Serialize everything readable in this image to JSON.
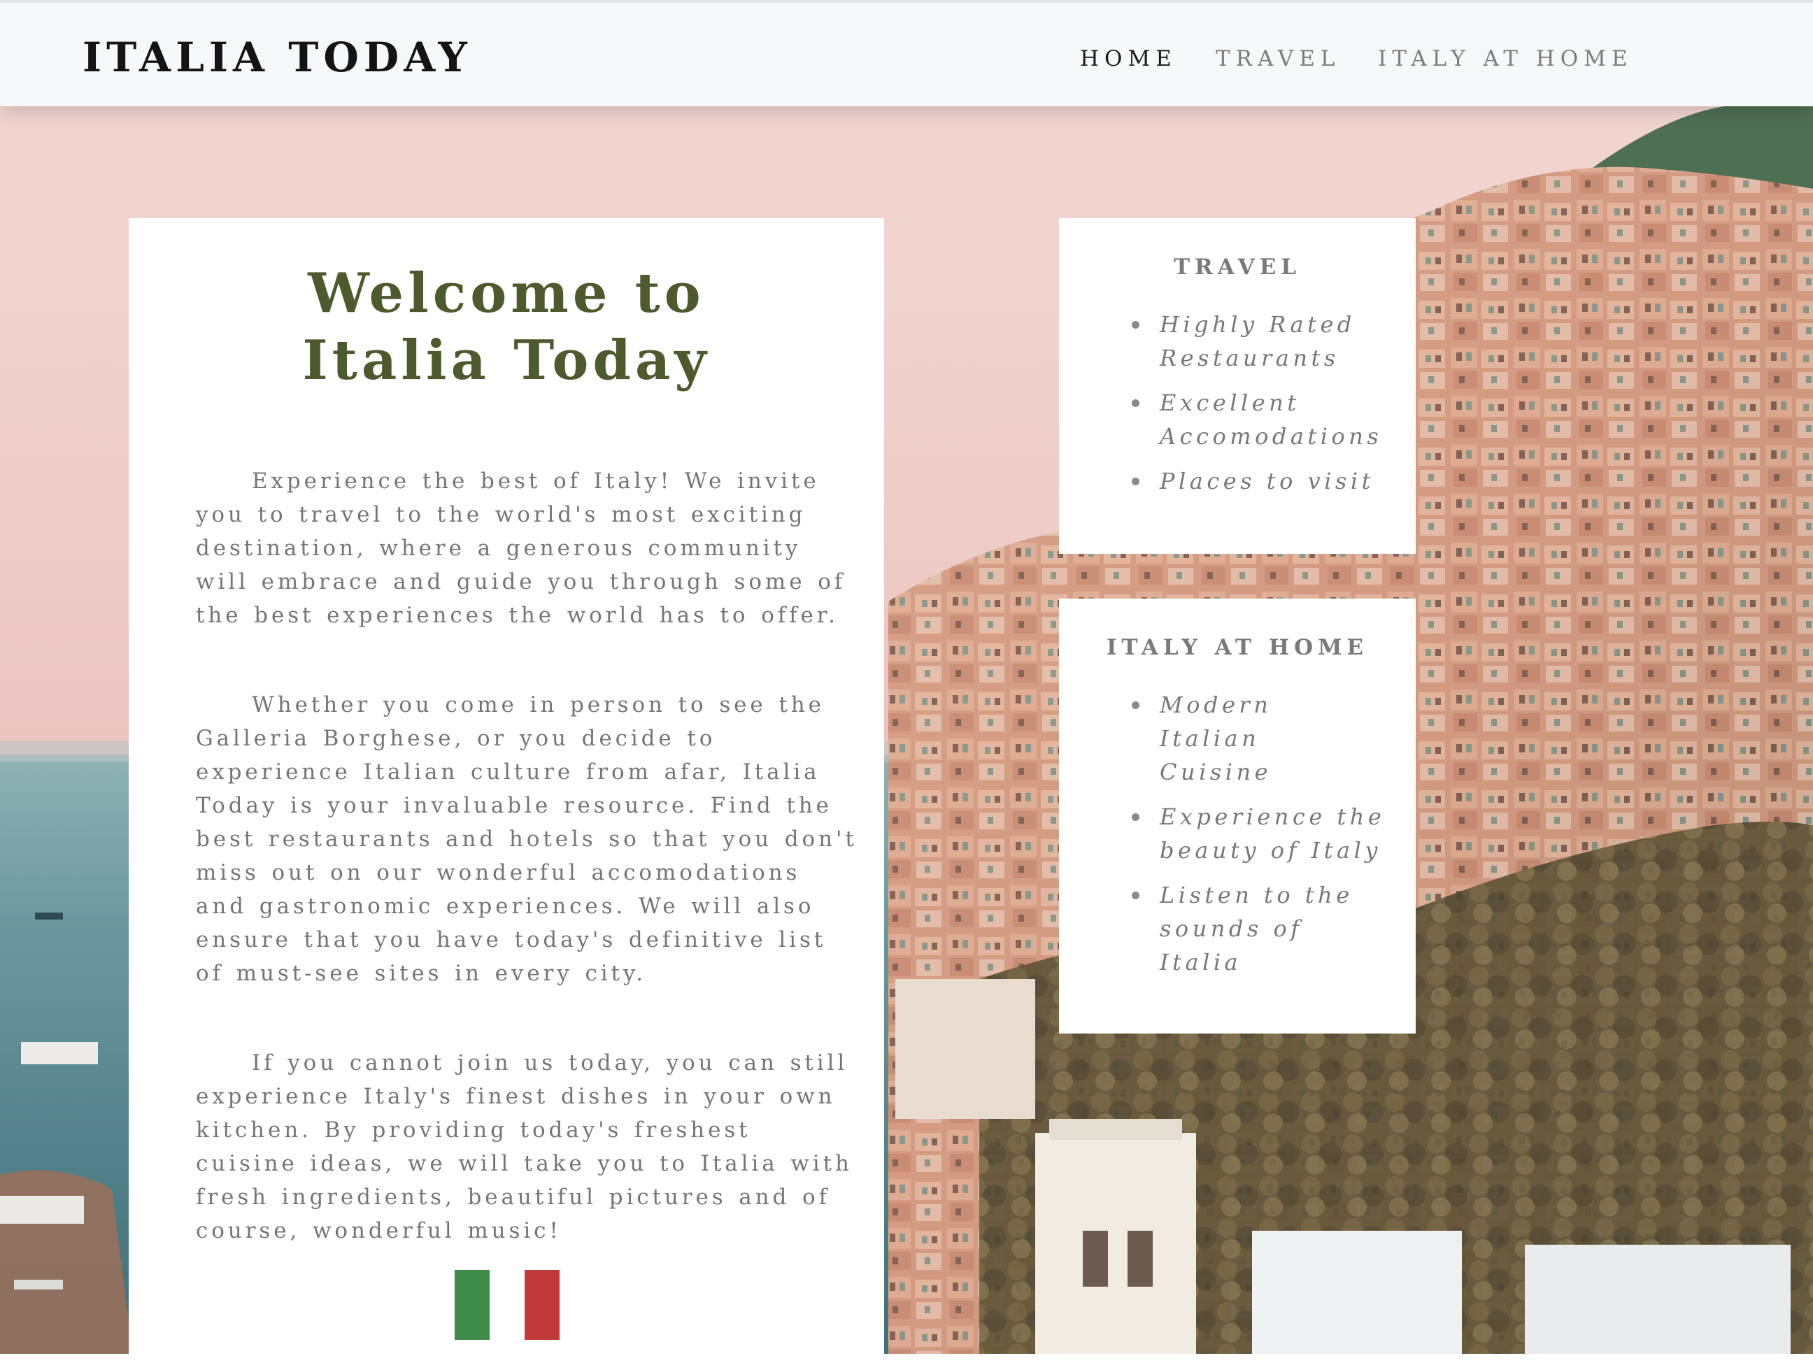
{
  "nav": {
    "brand": "ITALIA TODAY",
    "links": [
      {
        "label": "HOME",
        "active": true
      },
      {
        "label": "TRAVEL",
        "active": false
      },
      {
        "label": "ITALY AT HOME",
        "active": false
      }
    ]
  },
  "main": {
    "title_line1": "Welcome to",
    "title_line2": "Italia Today",
    "paragraphs": [
      "Experience the best of Italy! We invite you to travel to the world's most exciting destination, where a generous community will embrace and guide you through some of the best experiences the world has to offer.",
      "Whether you come in person to see the Galleria Borghese, or you decide to experience Italian culture from afar, Italia Today is your invaluable resource. Find the best restaurants and hotels so that you don't miss out on our wonderful accomodations and gastronomic experiences. We will also ensure that you have today's definitive list of must-see sites in every city.",
      "If you cannot join us today, you can still experience Italy's finest dishes in your own kitchen. By providing today's freshest cuisine ideas, we will take you to Italia with fresh ingredients, beautiful pictures and of course, wonderful music!"
    ],
    "flag_colors": [
      "#3e8c4a",
      "#ffffff",
      "#c0393b"
    ]
  },
  "travel_card": {
    "title": "TRAVEL",
    "items": [
      "Highly Rated Restaurants",
      "Excellent Accomodations",
      "Places to visit"
    ]
  },
  "home_card": {
    "title": "ITALY AT HOME",
    "items": [
      "Modern Italian Cuisine",
      "Experience the beauty of Italy",
      "Listen to the sounds of Italia"
    ]
  },
  "background": {
    "image_name": "hillside-town-by-the-sea-photo",
    "sky_color": "#f0d0cc",
    "sea_color": "#5e8d96",
    "town_color": "#d99d84"
  }
}
